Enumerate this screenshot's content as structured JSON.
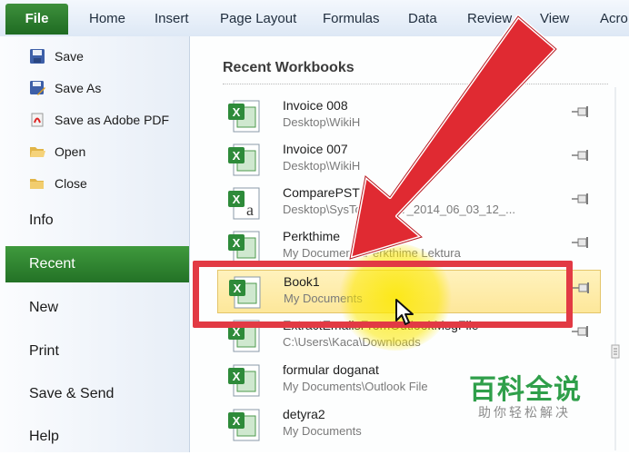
{
  "ribbon": {
    "file_tab": "File",
    "tabs": [
      "Home",
      "Insert",
      "Page Layout",
      "Formulas",
      "Data",
      "Review",
      "View",
      "Acro"
    ]
  },
  "backstage": {
    "commands": [
      {
        "label": "Save",
        "icon": "floppy-disk-icon"
      },
      {
        "label": "Save As",
        "icon": "save-as-icon"
      },
      {
        "label": "Save as Adobe PDF",
        "icon": "adobe-pdf-icon"
      },
      {
        "label": "Open",
        "icon": "open-folder-icon"
      },
      {
        "label": "Close",
        "icon": "close-folder-icon"
      }
    ],
    "nav": [
      "Info",
      "Recent",
      "New",
      "Print",
      "Save & Send",
      "Help"
    ],
    "active_nav": "Recent"
  },
  "recent": {
    "heading": "Recent Workbooks",
    "items": [
      {
        "name": "Invoice 008",
        "path": "Desktop\\WikiH"
      },
      {
        "name": "Invoice 007",
        "path": "Desktop\\WikiH"
      },
      {
        "name": "ComparePST",
        "path": "Desktop\\SysTo",
        "path_tail": "litPST_2014_06_03_12_..."
      },
      {
        "name": "Perkthime",
        "path": "My Documents\\Perkthime Lektura"
      },
      {
        "name": "Book1",
        "path": "My Documents",
        "selected": true
      },
      {
        "name": "ExtractEmailsFromOutlookMsgFile",
        "path": "C:\\Users\\Kaca\\Downloads"
      },
      {
        "name": "formular doganat",
        "path": "My Documents\\Outlook File"
      },
      {
        "name": "detyra2",
        "path": "My Documents"
      }
    ]
  },
  "watermark": {
    "main": "百科全说",
    "sub": "助你轻松解决"
  },
  "colors": {
    "file_tab": "#2a7a2c",
    "nav_active": "#2f8a31",
    "highlight_box": "#e23a44",
    "arrow": "#e02a32",
    "cursor_glow": "#fce800",
    "watermark": "#2f9f4a"
  }
}
